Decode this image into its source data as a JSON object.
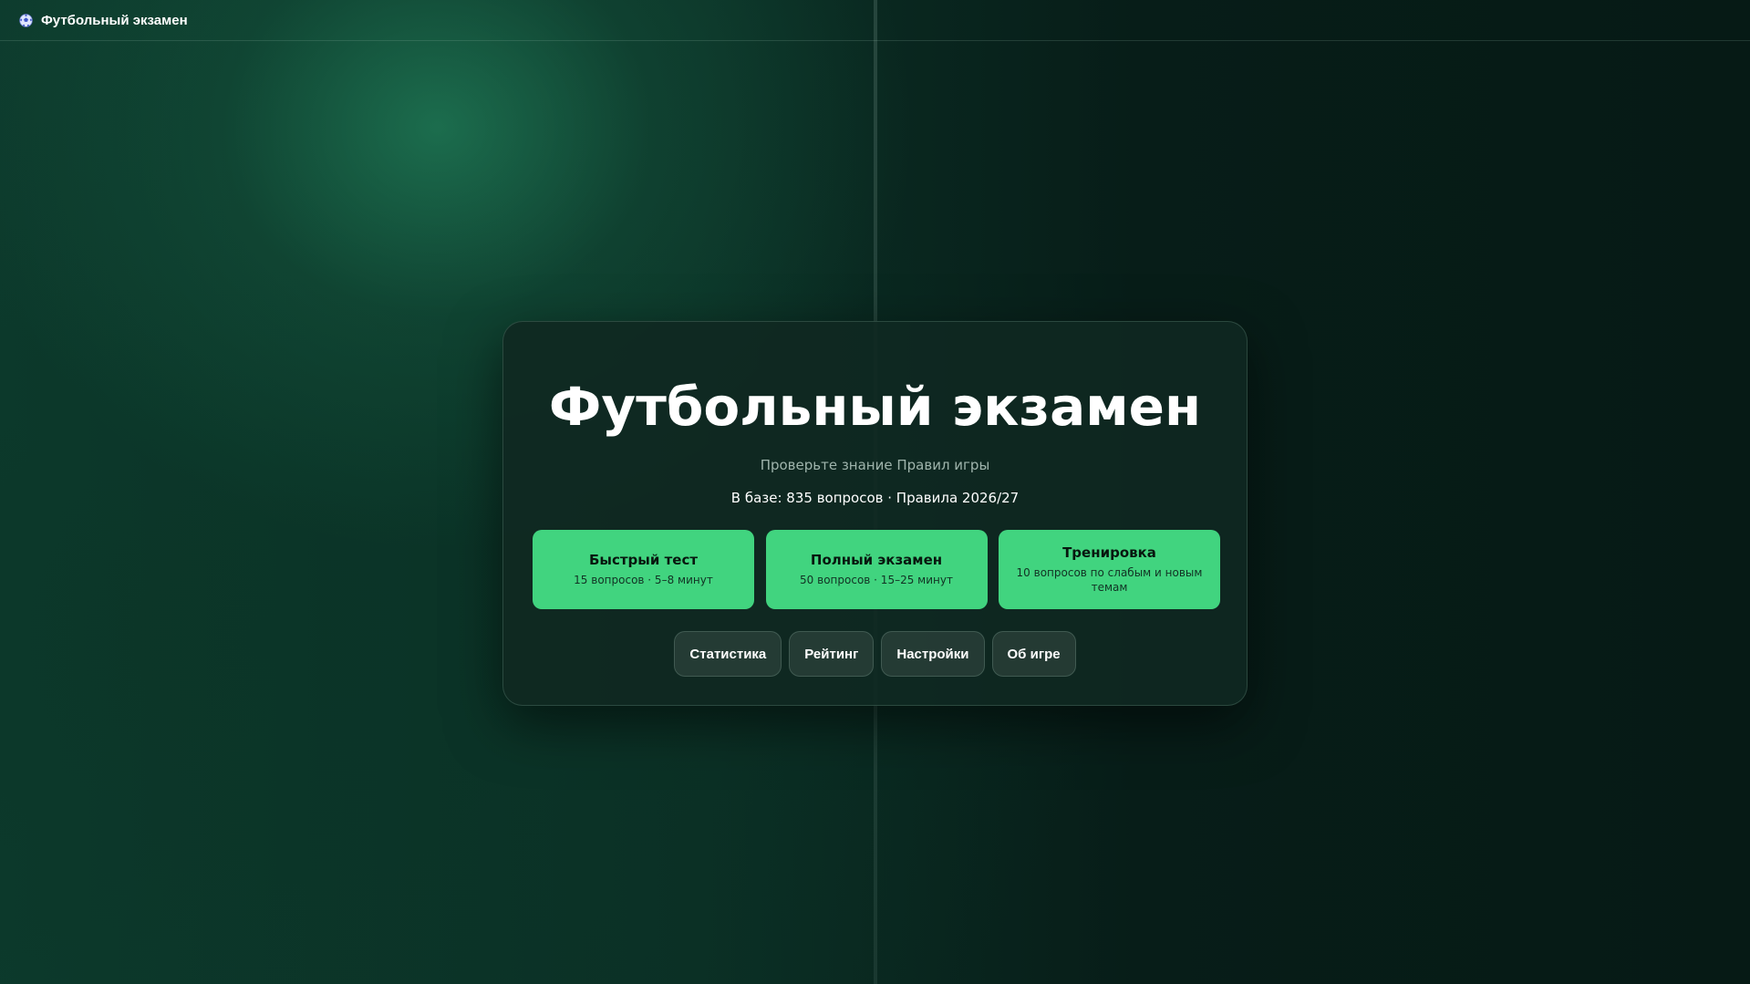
{
  "colors": {
    "accent": "#41d47f",
    "background_dark": "#061a15",
    "card_background": "#0f2821",
    "secondary_button": "#283e37",
    "subtitle_text": "#9fb4ac"
  },
  "topbar": {
    "icon": "soccer-ball-icon",
    "title": "Футбольный экзамен"
  },
  "main": {
    "title": "Футбольный экзамен",
    "subtitle": "Проверьте знание Правил игры",
    "info": "В базе: 835 вопросов · Правила 2026/27",
    "modes": [
      {
        "title": "Быстрый тест",
        "description": "15 вопросов · 5–8 минут"
      },
      {
        "title": "Полный экзамен",
        "description": "50 вопросов · 15–25 минут"
      },
      {
        "title": "Тренировка",
        "description": "10 вопросов по слабым и новым темам"
      }
    ],
    "nav": [
      {
        "label": "Статистика"
      },
      {
        "label": "Рейтинг"
      },
      {
        "label": "Настройки"
      },
      {
        "label": "Об игре"
      }
    ]
  }
}
